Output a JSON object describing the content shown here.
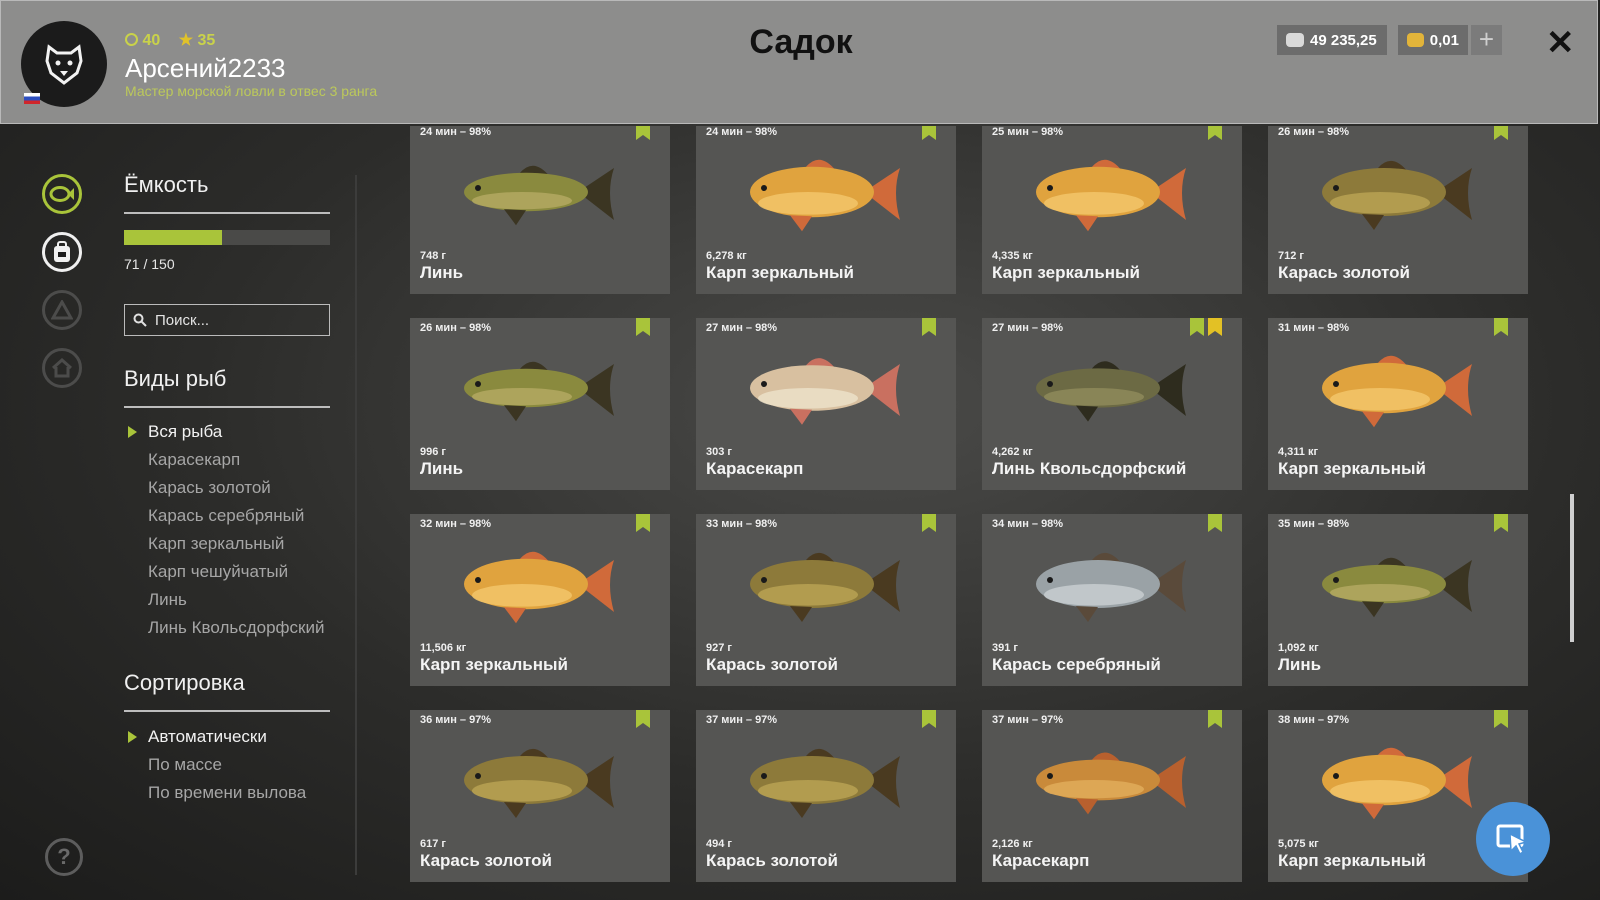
{
  "header": {
    "title": "Садок",
    "player": {
      "level": "40",
      "rank": "35",
      "name": "Арсений2233",
      "subtitle": "Мастер морской ловли в отвес 3 ранга"
    },
    "silver": "49 235,25",
    "gold": "0,01",
    "plus_label": "+",
    "close_label": "✕"
  },
  "sidebar": {
    "capacity_title": "Ёмкость",
    "capacity": {
      "current": 71,
      "max": 150,
      "text": "71 / 150",
      "fraction": 0.473
    },
    "search_placeholder": "Поиск...",
    "species_title": "Виды рыб",
    "species": [
      "Вся рыба",
      "Карасекарп",
      "Карась золотой",
      "Карась серебряный",
      "Карп зеркальный",
      "Карп чешуйчатый",
      "Линь",
      "Линь Квольсдорфский"
    ],
    "species_active": 0,
    "sort_title": "Сортировка",
    "sort": [
      "Автоматически",
      "По массе",
      "По времени вылова"
    ],
    "sort_active": 0,
    "help_label": "?"
  },
  "fish": [
    {
      "time": "24 мин – 98%",
      "weight": "748 г",
      "name": "Линь",
      "kind": "tench",
      "star": false
    },
    {
      "time": "24 мин – 98%",
      "weight": "6,278 кг",
      "name": "Карп зеркальный",
      "kind": "mirror",
      "star": false
    },
    {
      "time": "25 мин – 98%",
      "weight": "4,335 кг",
      "name": "Карп зеркальный",
      "kind": "mirror",
      "star": false
    },
    {
      "time": "26 мин – 98%",
      "weight": "712 г",
      "name": "Карась золотой",
      "kind": "crucian",
      "star": false
    },
    {
      "time": "26 мин – 98%",
      "weight": "996 г",
      "name": "Линь",
      "kind": "tench",
      "star": false
    },
    {
      "time": "27 мин – 98%",
      "weight": "303 г",
      "name": "Карасекарп",
      "kind": "hybrid",
      "star": false
    },
    {
      "time": "27 мин – 98%",
      "weight": "4,262 кг",
      "name": "Линь Квольсдорфский",
      "kind": "kwols",
      "star": true
    },
    {
      "time": "31 мин – 98%",
      "weight": "4,311 кг",
      "name": "Карп зеркальный",
      "kind": "mirror",
      "star": false
    },
    {
      "time": "32 мин – 98%",
      "weight": "11,506 кг",
      "name": "Карп зеркальный",
      "kind": "mirror",
      "star": false
    },
    {
      "time": "33 мин – 98%",
      "weight": "927 г",
      "name": "Карась золотой",
      "kind": "crucian",
      "star": false
    },
    {
      "time": "34 мин – 98%",
      "weight": "391 г",
      "name": "Карась серебряный",
      "kind": "silver",
      "star": false
    },
    {
      "time": "35 мин – 98%",
      "weight": "1,092 кг",
      "name": "Линь",
      "kind": "tench",
      "star": false
    },
    {
      "time": "36 мин – 97%",
      "weight": "617 г",
      "name": "Карась золотой",
      "kind": "crucian",
      "star": false
    },
    {
      "time": "37 мин – 97%",
      "weight": "494 г",
      "name": "Карась золотой",
      "kind": "crucian",
      "star": false
    },
    {
      "time": "37 мин – 97%",
      "weight": "2,126 кг",
      "name": "Карасекарп",
      "kind": "hybridgold",
      "star": false
    },
    {
      "time": "38 мин – 97%",
      "weight": "5,075 кг",
      "name": "Карп зеркальный",
      "kind": "mirror",
      "star": false
    }
  ],
  "colors": {
    "accent": "#a9c43a",
    "star": "#e3c125",
    "card": "#555553",
    "action_button": "#4a92d8"
  }
}
